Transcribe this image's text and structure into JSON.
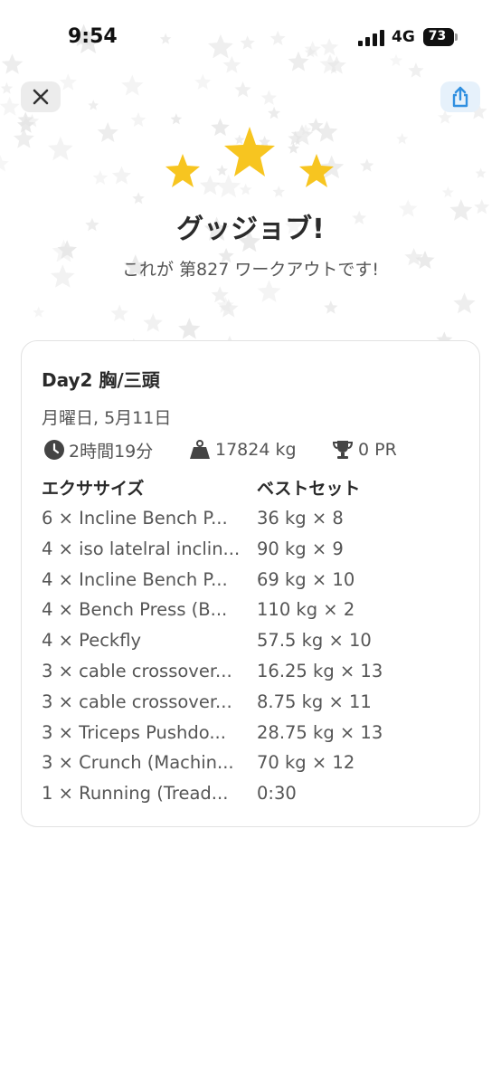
{
  "status_bar": {
    "time": "9:54",
    "network": "4G",
    "battery": "73"
  },
  "header": {
    "close_icon": "close-icon",
    "share_icon": "share-icon"
  },
  "hero": {
    "headline": "グッジョブ!",
    "subline": "これが 第827 ワークアウトです!",
    "star_color": "#f7c520"
  },
  "workout": {
    "title": "Day2 胸/三頭",
    "date": "月曜日, 5月11日",
    "stats": {
      "duration": "2時間19分",
      "volume": "17824 kg",
      "pr": "0 PR"
    },
    "columns": {
      "exercise": "エクササイズ",
      "best_set": "ベストセット"
    },
    "exercises": [
      {
        "name": "6 × Incline Bench P...",
        "best": "36 kg × 8"
      },
      {
        "name": "4 × iso latelral inclin...",
        "best": "90 kg × 9"
      },
      {
        "name": "4 × Incline Bench P...",
        "best": "69 kg × 10"
      },
      {
        "name": "4 × Bench Press (B...",
        "best": "110 kg × 2"
      },
      {
        "name": "4 × Peckfly",
        "best": "57.5 kg × 10"
      },
      {
        "name": "3 × cable crossover...",
        "best": "16.25 kg × 13"
      },
      {
        "name": "3 × cable crossover...",
        "best": "8.75 kg × 11"
      },
      {
        "name": "3 × Triceps Pushdo...",
        "best": "28.75 kg × 13"
      },
      {
        "name": "3 × Crunch (Machin...",
        "best": "70 kg × 12"
      },
      {
        "name": "1 × Running (Tread...",
        "best": "0:30"
      }
    ]
  },
  "colors": {
    "accent_blue": "#2f8fe0",
    "text_dark": "#2a2a2a",
    "text_muted": "#555555"
  }
}
